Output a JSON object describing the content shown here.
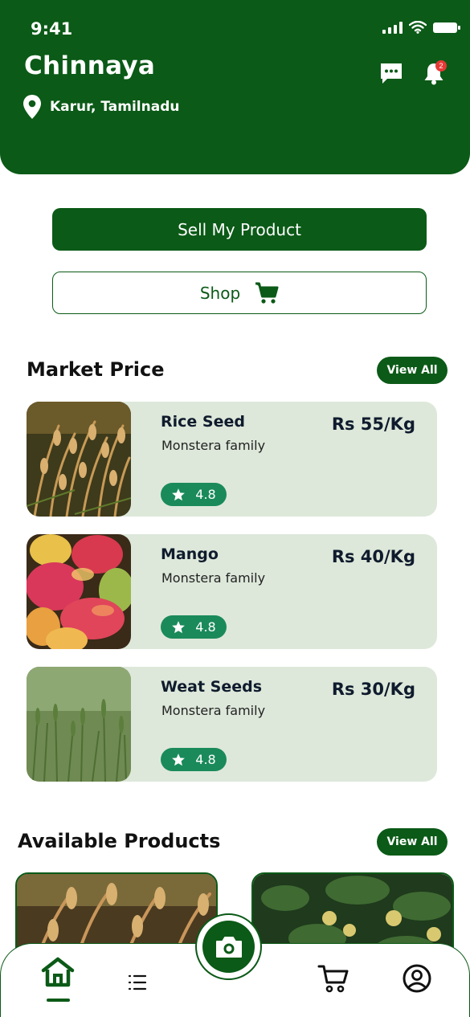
{
  "status": {
    "time": "9:41"
  },
  "header": {
    "user_name": "Chinnaya",
    "location": "Karur, Tamilnadu",
    "notification_count": "2",
    "background_color": "#0b5a17"
  },
  "actions": {
    "sell_label": "Sell My Product",
    "shop_label": "Shop"
  },
  "market": {
    "title": "Market Price",
    "view_all": "View All",
    "items": [
      {
        "name": "Rice Seed",
        "subtitle": "Monstera family",
        "price": "Rs 55/Kg",
        "rating": "4.8"
      },
      {
        "name": "Mango",
        "subtitle": "Monstera family",
        "price": "Rs 40/Kg",
        "rating": "4.8"
      },
      {
        "name": "Weat Seeds",
        "subtitle": "Monstera family",
        "price": "Rs 30/Kg",
        "rating": "4.8"
      }
    ]
  },
  "available": {
    "title": "Available Products",
    "view_all": "View All"
  },
  "nav": {
    "items": [
      "home-icon",
      "list-icon",
      "camera-icon",
      "cart-icon",
      "profile-icon"
    ],
    "active": "home",
    "accent": "#0b5a17"
  }
}
